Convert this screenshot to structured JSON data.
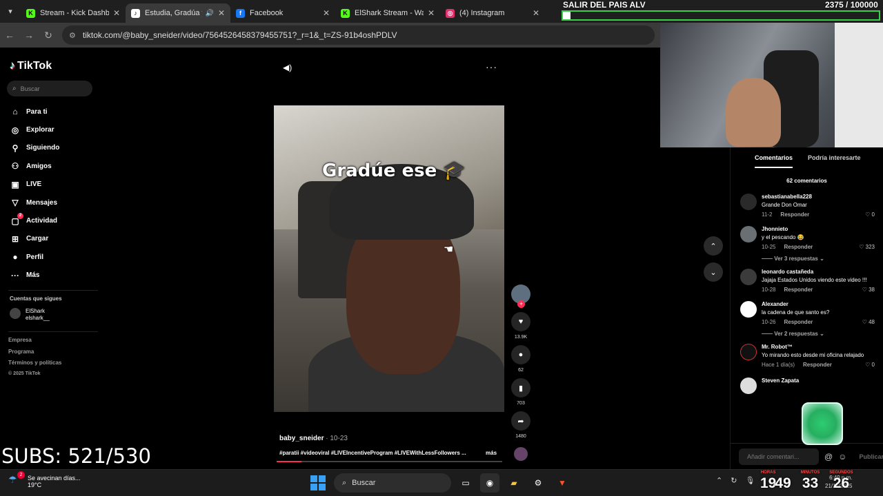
{
  "browser": {
    "tabs": [
      {
        "label": "Stream - Kick Dashboard",
        "icon": "kick-icon",
        "color": "#53fc18",
        "active": false
      },
      {
        "label": "Estudia, Gradúa y Trabaja",
        "icon": "tiktok-icon",
        "color": "#ffffff",
        "active": true
      },
      {
        "label": "Facebook",
        "icon": "facebook-icon",
        "color": "#1877f2",
        "active": false
      },
      {
        "label": "ElShark Stream - Watch",
        "icon": "kick-icon",
        "color": "#53fc18",
        "active": false
      },
      {
        "label": "(4) Instagram",
        "icon": "instagram-icon",
        "color": "#e1306c",
        "active": false
      }
    ],
    "url": "tiktok.com/@baby_sneider/video/7564526458379455751?_r=1&_t=ZS-91b4oshPDLV"
  },
  "tiktok": {
    "logo": "TikTok",
    "search_placeholder": "Buscar",
    "nav": [
      {
        "label": "Para ti",
        "icon": "home-icon"
      },
      {
        "label": "Explorar",
        "icon": "compass-icon"
      },
      {
        "label": "Siguiendo",
        "icon": "following-icon"
      },
      {
        "label": "Amigos",
        "icon": "friends-icon"
      },
      {
        "label": "LIVE",
        "icon": "live-icon"
      },
      {
        "label": "Mensajes",
        "icon": "messages-icon"
      },
      {
        "label": "Actividad",
        "icon": "activity-icon",
        "badge": "2"
      },
      {
        "label": "Cargar",
        "icon": "upload-icon"
      },
      {
        "label": "Perfil",
        "icon": "profile-icon"
      },
      {
        "label": "Más",
        "icon": "more-icon"
      }
    ],
    "following_title": "Cuentas que sigues",
    "following_user": {
      "name": "ElShark",
      "handle": "elshark__"
    },
    "footer": [
      "Empresa",
      "Programa",
      "Términos y políticas",
      "© 2025 TikTok"
    ]
  },
  "video": {
    "caption": "Gradúe ese 🎓",
    "author": "baby_sneider",
    "date": " · 10-23",
    "tags": "#paratii #videoviral #LIVEIncentiveProgram #LIVEWithLessFollowers ...",
    "more": "más",
    "progress": 0.11,
    "likes": "13.9K",
    "comments": "62",
    "saves": "703",
    "shares": "1480"
  },
  "overlay": {
    "title": "SALIR DEL PAIS ALV",
    "goal": "2375 / 100000",
    "goal_progress": 0.024,
    "subs": "SUBS: 521/530"
  },
  "comments": {
    "tab_active": "Comentarios",
    "tab_other": "Podría interesarte",
    "count": "62 comentarios",
    "items": [
      {
        "user": "sebastianabella228",
        "text": "Grande Don Omar",
        "date": "11-2",
        "reply": "Responder",
        "likes": "0"
      },
      {
        "user": "Jhonnieto",
        "text": "y el pescando 😂",
        "date": "10-25",
        "reply": "Responder",
        "likes": "323",
        "replies": "Ver 3 respuestas"
      },
      {
        "user": "leonardo castañeda",
        "text": "Jajaja Estados Unidos viendo este video !!!",
        "date": "10-28",
        "reply": "Responder",
        "likes": "38"
      },
      {
        "user": "Alexander",
        "text": "la cadena de que santo es?",
        "date": "10-26",
        "reply": "Responder",
        "likes": "48",
        "replies": "Ver 2 respuestas"
      },
      {
        "user": "Mr. Robot™",
        "text": "Yo mirando esto desde mi oficina relajado",
        "date": "Hace 1 día(s)",
        "reply": "Responder",
        "likes": "0"
      },
      {
        "user": "Steven Zapata",
        "text": "",
        "date": "",
        "reply": "",
        "likes": ""
      }
    ],
    "input_placeholder": "Añadir comentari...",
    "publish": "Publicar"
  },
  "taskbar": {
    "weather_title": "Se avecinan días...",
    "weather_temp": "19°C",
    "weather_badge": "2",
    "search": "Buscar",
    "time": "6:49 p.m.",
    "date": "21/11/2025",
    "lang": "ESP\nLAA"
  },
  "counter": {
    "hours": "19",
    "minutes": "33",
    "seconds": "26",
    "hours_label": "HORAS",
    "minutes_label": "MINUTOS",
    "seconds_label": "SEGUNDOS",
    "days": "49"
  }
}
